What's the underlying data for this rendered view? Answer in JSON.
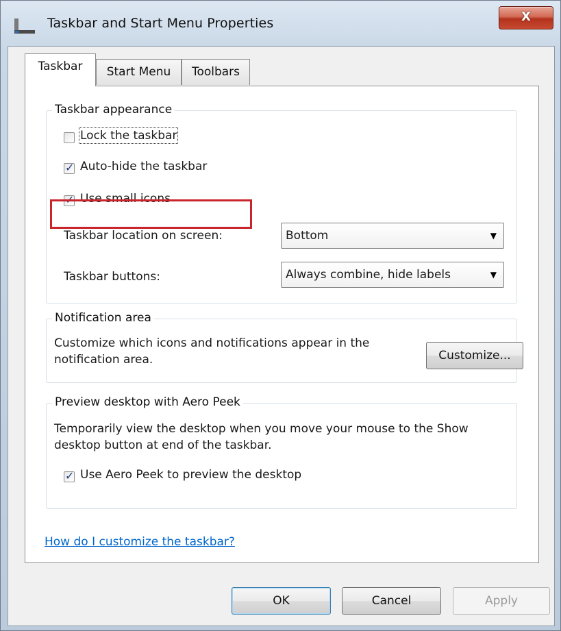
{
  "window": {
    "title": "Taskbar and Start Menu Properties",
    "close_label": "X"
  },
  "tabs": [
    {
      "label": "Taskbar",
      "active": true
    },
    {
      "label": "Start Menu",
      "active": false
    },
    {
      "label": "Toolbars",
      "active": false
    }
  ],
  "appearance": {
    "legend": "Taskbar appearance",
    "lock_taskbar": {
      "label": "Lock the taskbar",
      "checked": false
    },
    "auto_hide": {
      "label": "Auto-hide the taskbar",
      "checked": true
    },
    "small_icons": {
      "label": "Use small icons",
      "checked": true
    },
    "location_label": "Taskbar location on screen:",
    "location_value": "Bottom",
    "buttons_label": "Taskbar buttons:",
    "buttons_value": "Always combine, hide labels"
  },
  "notification": {
    "legend": "Notification area",
    "description": "Customize which icons and notifications appear in the notification area.",
    "customize_label": "Customize..."
  },
  "aero_peek": {
    "legend": "Preview desktop with Aero Peek",
    "description": "Temporarily view the desktop when you move your mouse to the Show desktop button at end of the taskbar.",
    "checkbox": {
      "label": "Use Aero Peek to preview the desktop",
      "checked": true
    }
  },
  "help_link": "How do I customize the taskbar?",
  "footer": {
    "ok_label": "OK",
    "cancel_label": "Cancel",
    "apply_label": "Apply"
  },
  "colors": {
    "highlight_border": "#c8252b",
    "link": "#0066cc"
  }
}
